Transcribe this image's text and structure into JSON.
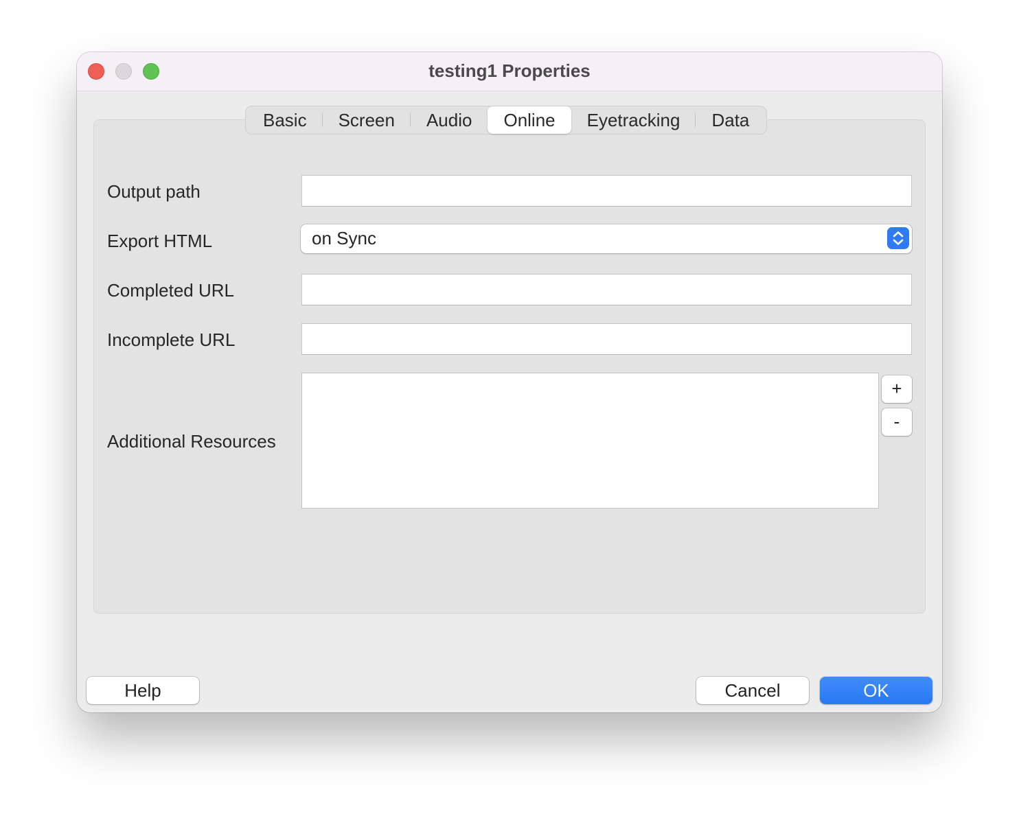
{
  "window": {
    "title": "testing1 Properties"
  },
  "tabs": [
    {
      "label": "Basic",
      "active": false
    },
    {
      "label": "Screen",
      "active": false
    },
    {
      "label": "Audio",
      "active": false
    },
    {
      "label": "Online",
      "active": true
    },
    {
      "label": "Eyetracking",
      "active": false
    },
    {
      "label": "Data",
      "active": false
    }
  ],
  "form": {
    "output_path": {
      "label": "Output path",
      "value": ""
    },
    "export_html": {
      "label": "Export HTML",
      "value": "on Sync"
    },
    "completed_url": {
      "label": "Completed URL",
      "value": ""
    },
    "incomplete_url": {
      "label": "Incomplete URL",
      "value": ""
    },
    "additional_resources": {
      "label": "Additional Resources",
      "add_label": "+",
      "remove_label": "-"
    }
  },
  "buttons": {
    "help": "Help",
    "cancel": "Cancel",
    "ok": "OK"
  },
  "colors": {
    "accent": "#2f7bf5",
    "close": "#ee5f57",
    "minimize": "#dcd8dc",
    "maximize": "#5fc454"
  }
}
